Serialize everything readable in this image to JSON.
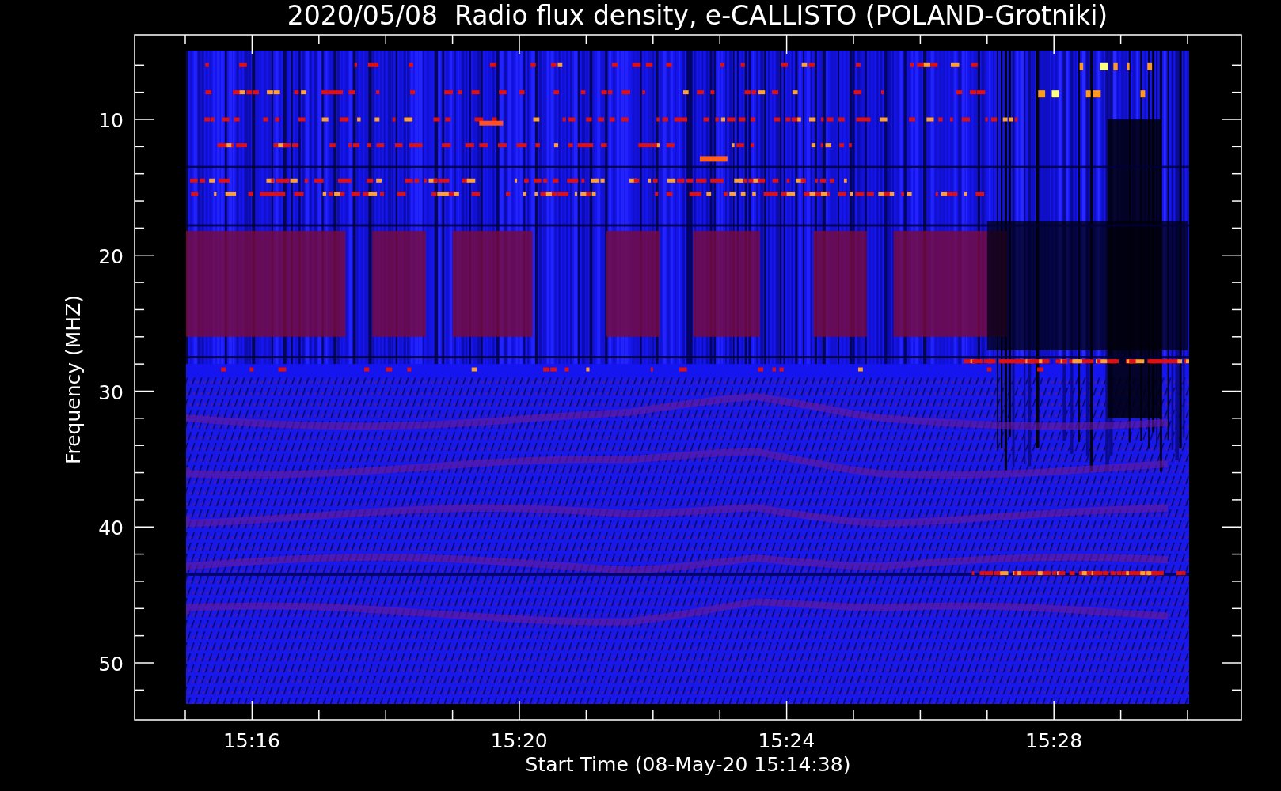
{
  "title": "2020/05/08  Radio flux density, e-CALLISTO (POLAND-Grotniki)",
  "xlabel": "Start Time (08-May-20 15:14:38)",
  "ylabel": "Frequency (MHZ)",
  "xticks": [
    "15:16",
    "15:20",
    "15:24",
    "15:28"
  ],
  "yticks": [
    "10",
    "20",
    "30",
    "40",
    "50"
  ],
  "spectrogram": {
    "kind": "picture"
  }
}
